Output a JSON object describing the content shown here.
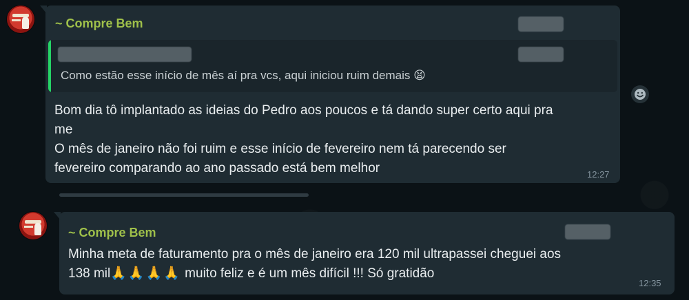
{
  "messages": [
    {
      "sender": "~ Compre Bem",
      "quote": {
        "text": "Como estão esse início de mês aí pra vcs, aqui iniciou ruim demais",
        "emoji": "😫"
      },
      "lines": [
        "Bom dia  tô implantado as ideias do Pedro aos poucos e tá dando super certo aqui pra",
        "me",
        "O mês de janeiro não  foi ruim e esse início  de fevereiro  nem tá parecendo ser",
        "fevereiro comparando ao ano passado está  bem melhor"
      ],
      "time": "12:27"
    },
    {
      "sender": "~ Compre Bem",
      "lines": [
        "Minha meta de faturamento  pra o mês de janeiro era 120 mil ultrapassei cheguei aos"
      ],
      "line2_start": "138 mil",
      "line2_emojis": "🙏🙏🙏🙏",
      "line2_end": " muito feliz e é  um mês  difícil !!! Só gratidão",
      "time": "12:35"
    }
  ],
  "icons": {
    "reaction_button": "emoji-reaction-icon"
  }
}
